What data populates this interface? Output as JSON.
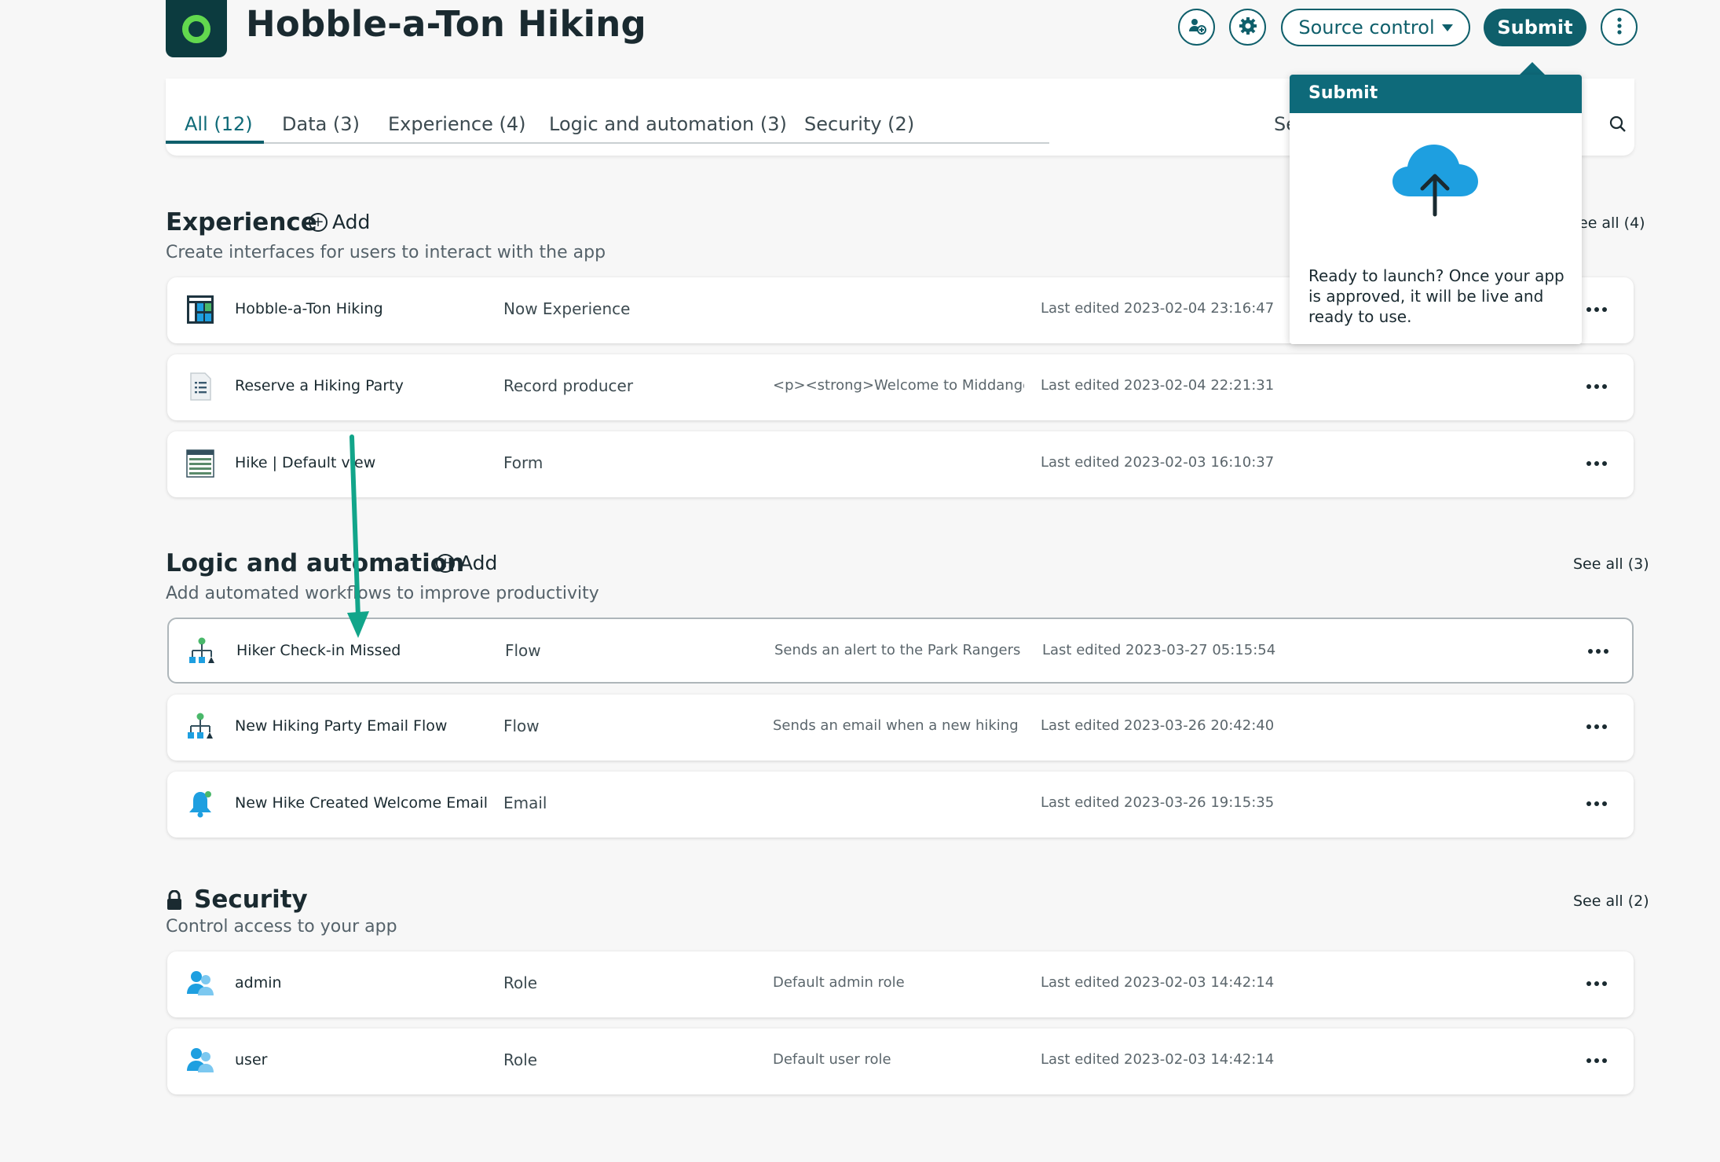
{
  "header": {
    "app_title": "Hobble-a-Ton Hiking",
    "source_control_label": "Source control",
    "submit_label": "Submit"
  },
  "tabs": [
    {
      "label": "All (12)",
      "active": true
    },
    {
      "label": "Data (3)"
    },
    {
      "label": "Experience (4)"
    },
    {
      "label": "Logic and automation (3)"
    },
    {
      "label": "Security (2)"
    }
  ],
  "search_partial": "Se",
  "sections": {
    "experience": {
      "title": "Experience",
      "add_label": "Add",
      "subtitle": "Create interfaces for users to interact with the app",
      "see_all": "ee all (4)",
      "rows": [
        {
          "name": "Hobble-a-Ton Hiking",
          "type": "Now Experience",
          "desc": "",
          "edited": "Last edited 2023-02-04 23:16:47",
          "icon": "experience-page-icon"
        },
        {
          "name": "Reserve a Hiking Party",
          "type": "Record producer",
          "desc": "<p><strong>Welcome to Middange...",
          "edited": "Last edited 2023-02-04 22:21:31",
          "icon": "document-list-icon"
        },
        {
          "name": "Hike | Default view",
          "type": "Form",
          "desc": "",
          "edited": "Last edited 2023-02-03 16:10:37",
          "icon": "form-table-icon"
        }
      ]
    },
    "logic": {
      "title": "Logic and automation",
      "add_label": "Add",
      "subtitle": "Add automated workflows to improve productivity",
      "see_all": "See all (3)",
      "rows": [
        {
          "name": "Hiker Check-in Missed",
          "type": "Flow",
          "desc": "Sends an alert to the Park Rangers ...",
          "edited": "Last edited 2023-03-27 05:15:54",
          "icon": "flow-icon"
        },
        {
          "name": "New Hiking Party Email Flow",
          "type": "Flow",
          "desc": "Sends an email when a new hiking p...",
          "edited": "Last edited 2023-03-26 20:42:40",
          "icon": "flow-icon"
        },
        {
          "name": "New Hike Created Welcome Email",
          "type": "Email",
          "desc": "",
          "edited": "Last edited 2023-03-26 19:15:35",
          "icon": "bell-icon"
        }
      ]
    },
    "security": {
      "title": "Security",
      "subtitle": "Control access to your app",
      "see_all": "See all (2)",
      "rows": [
        {
          "name": "admin",
          "type": "Role",
          "desc": "Default admin role",
          "edited": "Last edited 2023-02-03 14:42:14",
          "icon": "users-icon"
        },
        {
          "name": "user",
          "type": "Role",
          "desc": "Default user role",
          "edited": "Last edited 2023-02-03 14:42:14",
          "icon": "users-icon"
        }
      ]
    }
  },
  "popover": {
    "title": "Submit",
    "text": "Ready to launch? Once your app is approved, it will be live and ready to use."
  },
  "colors": {
    "brand": "#0f5f6b",
    "popover_header": "#0e6a7a",
    "logo_bg": "#0c3b3f",
    "logo_ring": "#62d84e",
    "annotation_arrow": "#12a58a",
    "cloud": "#1e9fe0"
  }
}
